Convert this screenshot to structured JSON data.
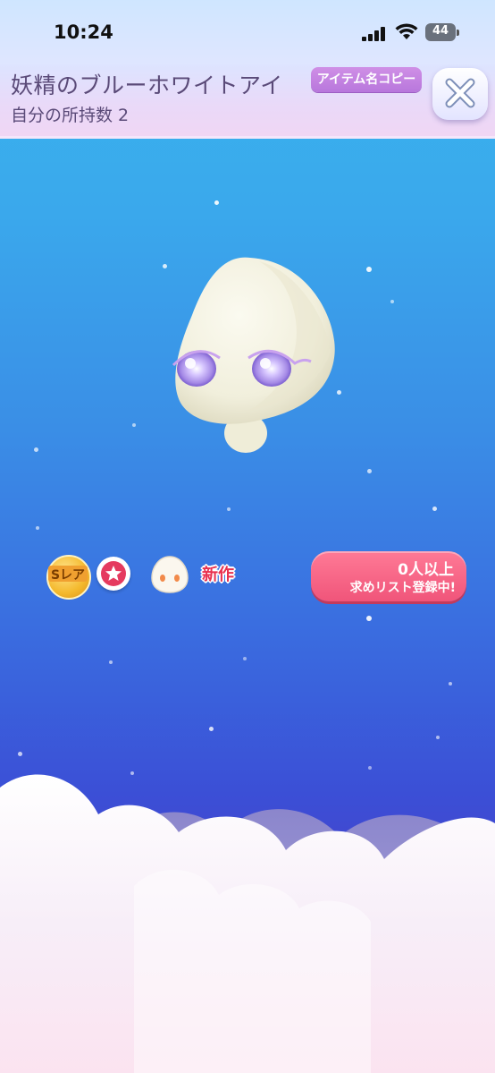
{
  "status_bar": {
    "time": "10:24",
    "battery": "44"
  },
  "header": {
    "item_name": "妖精のブルーホワイトアイ",
    "owned_label": "自分の所持数 2",
    "copy_name_button": "アイテム名コピー",
    "close_icon": "close-x-icon"
  },
  "item": {
    "rarity_label": "Sレア",
    "new_label": "新作"
  },
  "wish_list": {
    "count_text": "0人以上",
    "status_text": "求めリスト登録中!"
  },
  "colors": {
    "accent_pink": "#f0557a",
    "copy_button_purple": "#b877dc",
    "title_text": "#5a4a78"
  }
}
